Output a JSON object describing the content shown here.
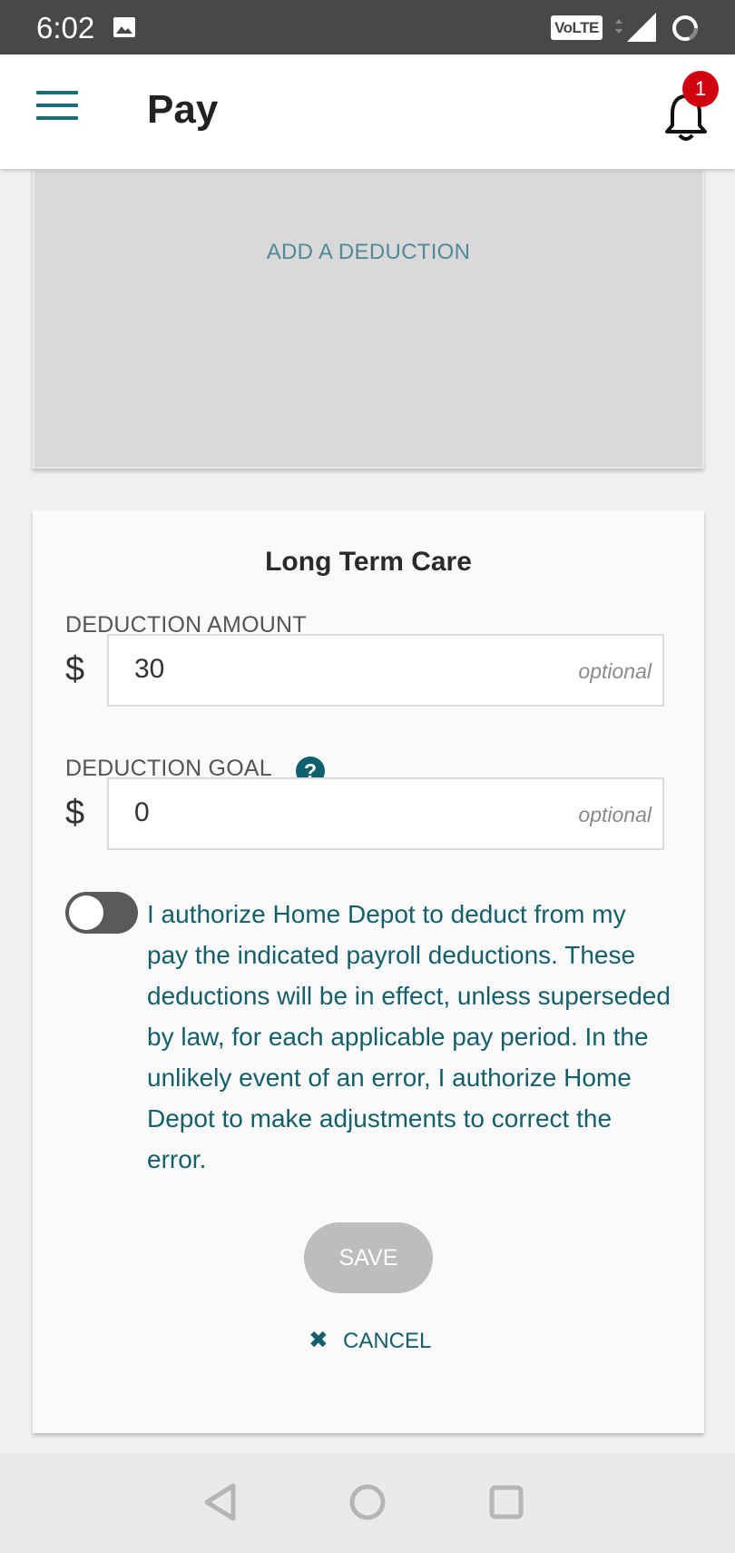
{
  "status_bar": {
    "time": "6:02",
    "network_label": "VoLTE",
    "network_type": "4G",
    "icons": [
      "image-icon",
      "volte-icon",
      "signal-icon",
      "battery-icon"
    ]
  },
  "app_bar": {
    "title": "Pay",
    "notification_count": "1",
    "accent_color": "#1a6c7a",
    "badge_color": "#d0020f"
  },
  "add_deduction": {
    "label": "ADD A DEDUCTION"
  },
  "deduction_form": {
    "title": "Long Term Care",
    "amount": {
      "label": "DEDUCTION AMOUNT",
      "currency": "$",
      "value": "30",
      "hint": "optional"
    },
    "goal": {
      "label": "DEDUCTION GOAL",
      "help_symbol": "?",
      "currency": "$",
      "value": "0",
      "hint": "optional"
    },
    "authorization": {
      "enabled": false,
      "text": "I authorize Home Depot to deduct from my pay the indicated payroll deductions. These deductions will be in effect, unless superseded by law, for each applicable pay period. In the unlikely event of an error, I authorize Home Depot to make adjustments to correct the error."
    },
    "save_label": "SAVE",
    "cancel_label": "CANCEL",
    "cancel_symbol": "✖"
  },
  "nav_bar": {
    "buttons": [
      "back-icon",
      "home-icon",
      "recents-icon"
    ]
  }
}
